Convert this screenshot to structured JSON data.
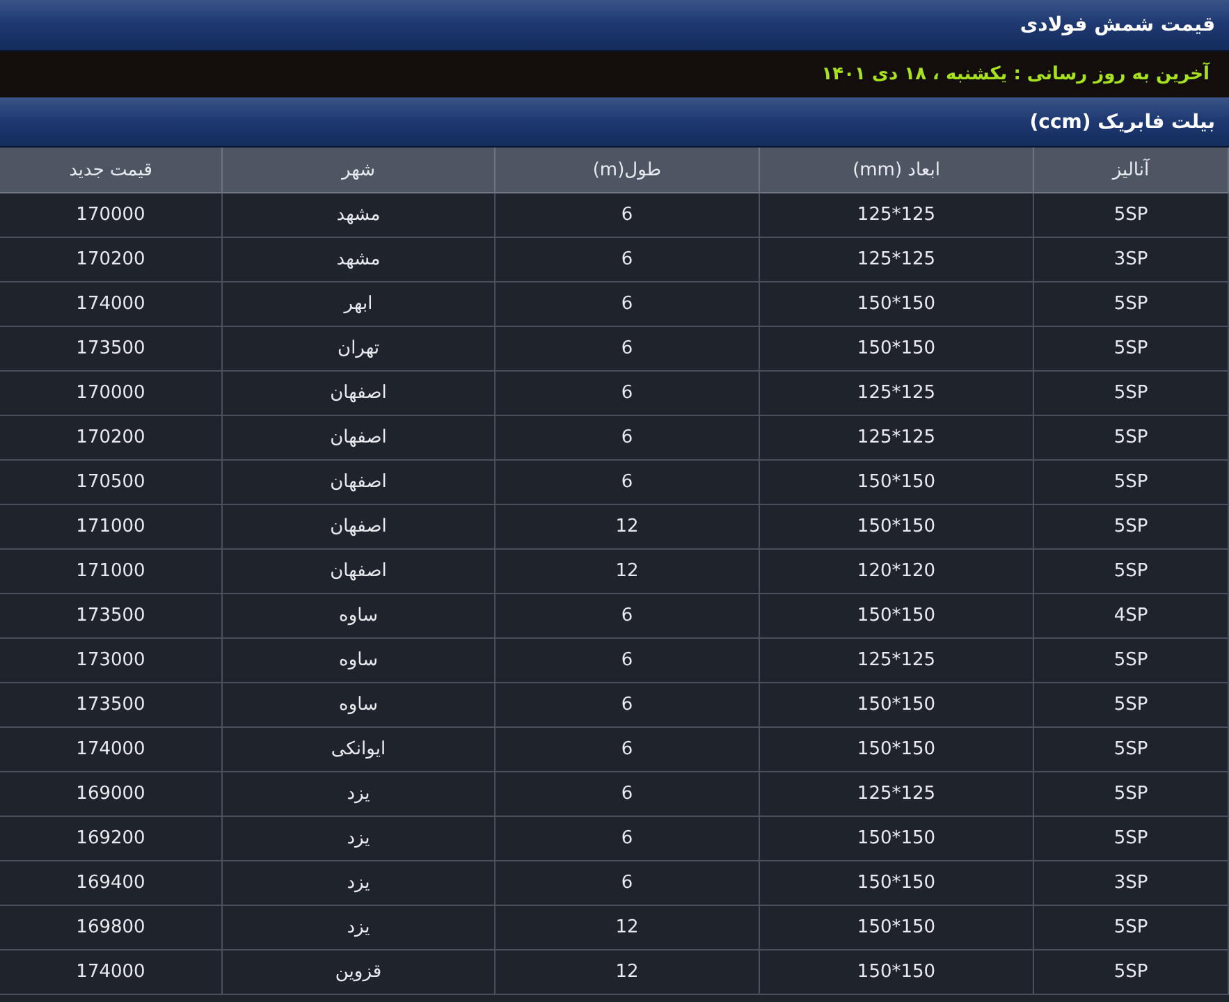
{
  "title": "قیمت شمش فولادی",
  "last_update": "آخرین به روز رسانی : یکشنبه ، ۱۸ دی ۱۴۰۱",
  "section_title": "بیلت فابریک (ccm)",
  "table": {
    "columns": [
      "آنالیز",
      "ابعاد (mm)",
      "طول(m)",
      "شهر",
      "قیمت جدید"
    ],
    "rows": [
      [
        "5SP",
        "125*125",
        "6",
        "مشهد",
        "170000"
      ],
      [
        "3SP",
        "125*125",
        "6",
        "مشهد",
        "170200"
      ],
      [
        "5SP",
        "150*150",
        "6",
        "ابهر",
        "174000"
      ],
      [
        "5SP",
        "150*150",
        "6",
        "تهران",
        "173500"
      ],
      [
        "5SP",
        "125*125",
        "6",
        "اصفهان",
        "170000"
      ],
      [
        "5SP",
        "125*125",
        "6",
        "اصفهان",
        "170200"
      ],
      [
        "5SP",
        "150*150",
        "6",
        "اصفهان",
        "170500"
      ],
      [
        "5SP",
        "150*150",
        "12",
        "اصفهان",
        "171000"
      ],
      [
        "5SP",
        "120*120",
        "12",
        "اصفهان",
        "171000"
      ],
      [
        "4SP",
        "150*150",
        "6",
        "ساوه",
        "173500"
      ],
      [
        "5SP",
        "125*125",
        "6",
        "ساوه",
        "173000"
      ],
      [
        "5SP",
        "150*150",
        "6",
        "ساوه",
        "173500"
      ],
      [
        "5SP",
        "150*150",
        "6",
        "ایوانکی",
        "174000"
      ],
      [
        "5SP",
        "125*125",
        "6",
        "یزد",
        "169000"
      ],
      [
        "5SP",
        "150*150",
        "6",
        "یزد",
        "169200"
      ],
      [
        "3SP",
        "150*150",
        "6",
        "یزد",
        "169400"
      ],
      [
        "5SP",
        "150*150",
        "12",
        "یزد",
        "169800"
      ],
      [
        "5SP",
        "150*150",
        "12",
        "قزوین",
        "174000"
      ]
    ]
  }
}
